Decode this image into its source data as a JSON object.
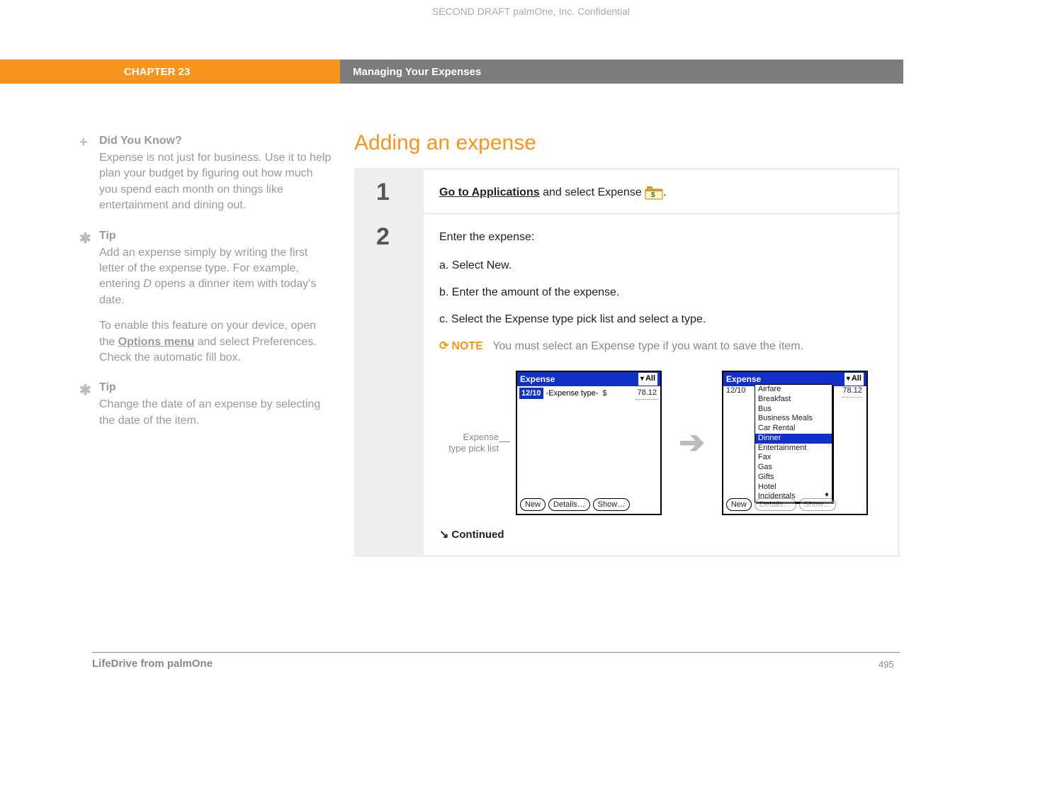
{
  "confidential": "SECOND DRAFT palmOne, Inc.  Confidential",
  "chapter_label": "CHAPTER 23",
  "chapter_title": "Managing Your Expenses",
  "sidebar": {
    "dyk": {
      "title": "Did You Know?",
      "text": "Expense is not just for business. Use it to help plan your budget by figuring out how much you spend each month on things like entertainment and dining out."
    },
    "tip1": {
      "title": "Tip",
      "text_before": "Add an expense simply by writing the first letter of the expense type. For example, entering ",
      "text_em": "D",
      "text_after": " opens a dinner item with today's date.",
      "text2_before": "To enable this feature on your device, open the ",
      "text2_link": "Options menu",
      "text2_after": " and select Preferences. Check the automatic fill box."
    },
    "tip2": {
      "title": "Tip",
      "text": "Change the date of an expense by selecting the date of the item."
    }
  },
  "main": {
    "heading": "Adding an expense",
    "step1": {
      "num": "1",
      "link_text": "Go to Applications",
      "after_text": " and select Expense ",
      "period": "."
    },
    "step2": {
      "num": "2",
      "intro": "Enter the expense:",
      "a": "a.  Select New.",
      "b": "b.  Enter the amount of the expense.",
      "c": "c.  Select the Expense type pick list and select a type.",
      "note_label": "NOTE",
      "note_text": "You must select an Expense type if you want to save the item.",
      "shot_label_l1": "Expense",
      "shot_label_l2": "type pick list",
      "continued": "Continued"
    }
  },
  "palm": {
    "title": "Expense",
    "all": "All",
    "date": "12/10",
    "type_placeholder": "-Expense type-",
    "currency": "$",
    "amount": "78.12",
    "btn_new": "New",
    "btn_details": "Details…",
    "btn_show": "Show…",
    "options": [
      "Airfare",
      "Breakfast",
      "Bus",
      "Business Meals",
      "Car Rental",
      "Dinner",
      "Entertainment",
      "Fax",
      "Gas",
      "Gifts",
      "Hotel",
      "Incidentals"
    ],
    "selected_index": 5
  },
  "footer": {
    "left": "LifeDrive from palmOne",
    "page": "495"
  }
}
